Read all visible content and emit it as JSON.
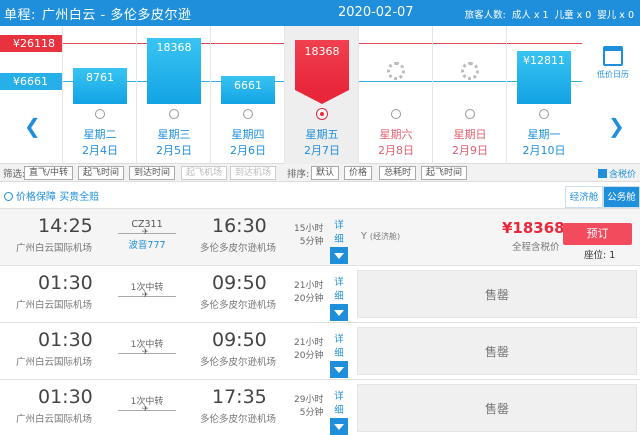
{
  "header": {
    "trip_type": "单程:",
    "route": "广州白云 - 多伦多皮尔逊",
    "date": "2020-02-07",
    "pax_label": "旅客人数:",
    "adult": "成人 x 1",
    "child": "儿童 x 0",
    "infant": "婴儿 x 0"
  },
  "calendar": {
    "high_price": "¥26118",
    "low_price": "¥6661",
    "days": [
      {
        "weekday": "星期二",
        "date": "2月4日",
        "price": "8761",
        "price_value": 8761,
        "weekend": false,
        "selected": false,
        "loaded": true
      },
      {
        "weekday": "星期三",
        "date": "2月5日",
        "price": "18368",
        "price_value": 18368,
        "weekend": false,
        "selected": false,
        "loaded": true
      },
      {
        "weekday": "星期四",
        "date": "2月6日",
        "price": "6661",
        "price_value": 6661,
        "weekend": false,
        "selected": false,
        "loaded": true
      },
      {
        "weekday": "星期五",
        "date": "2月7日",
        "price": "18368",
        "price_value": 18368,
        "weekend": false,
        "selected": true,
        "loaded": true
      },
      {
        "weekday": "星期六",
        "date": "2月8日",
        "price": "",
        "price_value": null,
        "weekend": true,
        "selected": false,
        "loaded": false
      },
      {
        "weekday": "星期日",
        "date": "2月9日",
        "price": "",
        "price_value": null,
        "weekend": true,
        "selected": false,
        "loaded": false
      },
      {
        "weekday": "星期一",
        "date": "2月10日",
        "price": "¥12811",
        "price_value": 12811,
        "weekend": false,
        "selected": false,
        "loaded": true
      }
    ],
    "low_calendar_label": "低价日历"
  },
  "filters": {
    "filter_label": "筛选:",
    "filter_buttons": [
      "直飞/中转",
      "起飞时间",
      "到达时间",
      "起飞机场",
      "到达机场"
    ],
    "sort_label": "排序:",
    "sort_buttons": [
      "默认",
      "价格",
      "总耗时",
      "起飞时间"
    ],
    "tax_checkbox": "含税价"
  },
  "guard": {
    "text1": "价格保障",
    "text2": "买贵全赔"
  },
  "cabins": {
    "economy": "经济舱",
    "business": "公务舱"
  },
  "flights": [
    {
      "dep_time": "14:25",
      "dep_airport": "广州白云国际机场",
      "flight_no": "CZ311",
      "aircraft": "波音777",
      "transfer": "",
      "arr_time": "16:30",
      "arr_airport": "多伦多皮尔逊机场",
      "dur_h": "15小时",
      "dur_m": "5分钟",
      "detail": "详细",
      "fare_class": "Y",
      "fare_note": "(经济舱)",
      "price": "¥18368",
      "price_note": "全程含税价",
      "book": "预订",
      "seats": "座位: 1",
      "sold_out": false
    },
    {
      "dep_time": "01:30",
      "dep_airport": "广州白云国际机场",
      "flight_no": "",
      "aircraft": "",
      "transfer": "1次中转",
      "arr_time": "09:50",
      "arr_airport": "多伦多皮尔逊机场",
      "dur_h": "21小时",
      "dur_m": "20分钟",
      "detail": "详细",
      "sold_text": "售罄",
      "sold_out": true
    },
    {
      "dep_time": "01:30",
      "dep_airport": "广州白云国际机场",
      "flight_no": "",
      "aircraft": "",
      "transfer": "1次中转",
      "arr_time": "09:50",
      "arr_airport": "多伦多皮尔逊机场",
      "dur_h": "21小时",
      "dur_m": "20分钟",
      "detail": "详细",
      "sold_text": "售罄",
      "sold_out": true
    },
    {
      "dep_time": "01:30",
      "dep_airport": "广州白云国际机场",
      "flight_no": "",
      "aircraft": "",
      "transfer": "1次中转",
      "arr_time": "17:35",
      "arr_airport": "多伦多皮尔逊机场",
      "dur_h": "29小时",
      "dur_m": "5分钟",
      "detail": "详细",
      "sold_text": "售罄",
      "sold_out": true
    }
  ],
  "colors": {
    "accent": "#1f8fdc",
    "bar_blue": "#12a3e4",
    "bar_red": "#e8273a",
    "book_button": "#f24b5d"
  }
}
